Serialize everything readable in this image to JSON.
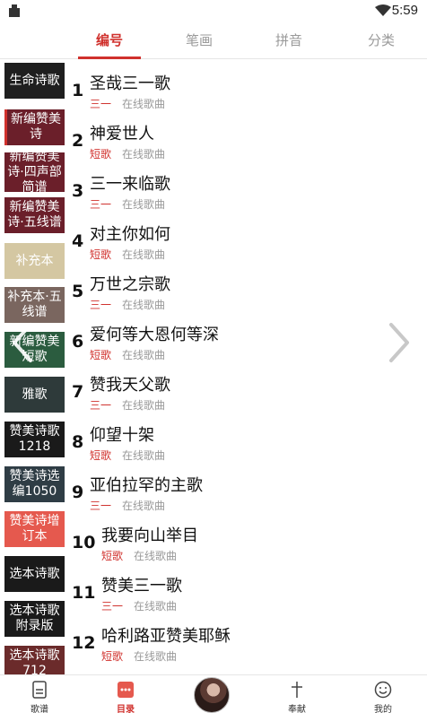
{
  "status_bar": {
    "time": "5:59"
  },
  "tabs": [
    {
      "label": "编号",
      "active": true
    },
    {
      "label": "笔画",
      "active": false
    },
    {
      "label": "拼音",
      "active": false
    },
    {
      "label": "分类",
      "active": false
    }
  ],
  "sidebar": {
    "items": [
      {
        "label": "生命诗歌",
        "color": "#1f1f1f"
      },
      {
        "label": "新编赞美诗",
        "color": "#6b1f2a",
        "active": true
      },
      {
        "label": "新编赞美诗·四声部简谱",
        "color": "#6b1f2a"
      },
      {
        "label": "新编赞美诗·五线谱",
        "color": "#6b1f2a"
      },
      {
        "label": "补充本",
        "color": "#d4c7a2"
      },
      {
        "label": "补充本·五线谱",
        "color": "#7a665f"
      },
      {
        "label": "新编赞美短歌",
        "color": "#2b5c3f"
      },
      {
        "label": "雅歌",
        "color": "#2e3a3a"
      },
      {
        "label": "赞美诗歌1218",
        "color": "#1a1a1a"
      },
      {
        "label": "赞美诗选编1050",
        "color": "#2f3d45"
      },
      {
        "label": "赞美诗增订本",
        "color": "#e5594e"
      },
      {
        "label": "选本诗歌",
        "color": "#1a1a1a"
      },
      {
        "label": "选本诗歌附录版",
        "color": "#1a1a1a"
      },
      {
        "label": "选本诗歌712",
        "color": "#6b2b2b"
      }
    ]
  },
  "songs": [
    {
      "num": "1",
      "title": "圣哉三一歌",
      "tag": "三一",
      "online": "在线歌曲"
    },
    {
      "num": "2",
      "title": "神爱世人",
      "tag": "短歌",
      "online": "在线歌曲"
    },
    {
      "num": "3",
      "title": "三一来临歌",
      "tag": "三一",
      "online": "在线歌曲"
    },
    {
      "num": "4",
      "title": "对主你如何",
      "tag": "短歌",
      "online": "在线歌曲"
    },
    {
      "num": "5",
      "title": "万世之宗歌",
      "tag": "三一",
      "online": "在线歌曲"
    },
    {
      "num": "6",
      "title": "爱何等大恩何等深",
      "tag": "短歌",
      "online": "在线歌曲"
    },
    {
      "num": "7",
      "title": "赞我天父歌",
      "tag": "三一",
      "online": "在线歌曲"
    },
    {
      "num": "8",
      "title": "仰望十架",
      "tag": "短歌",
      "online": "在线歌曲"
    },
    {
      "num": "9",
      "title": "亚伯拉罕的主歌",
      "tag": "三一",
      "online": "在线歌曲"
    },
    {
      "num": "10",
      "title": "我要向山举目",
      "tag": "短歌",
      "online": "在线歌曲"
    },
    {
      "num": "11",
      "title": "赞美三一歌",
      "tag": "三一",
      "online": "在线歌曲"
    },
    {
      "num": "12",
      "title": "哈利路亚赞美耶稣",
      "tag": "短歌",
      "online": "在线歌曲"
    }
  ],
  "bottom_nav": {
    "items": [
      {
        "label": "歌谱",
        "icon": "document-icon"
      },
      {
        "label": "目录",
        "icon": "list-icon",
        "active": true
      },
      {
        "label": "",
        "icon": "avatar"
      },
      {
        "label": "奉献",
        "icon": "cross-icon"
      },
      {
        "label": "我的",
        "icon": "smiley-icon"
      }
    ]
  },
  "colors": {
    "accent": "#d0312d",
    "muted": "#999999"
  }
}
